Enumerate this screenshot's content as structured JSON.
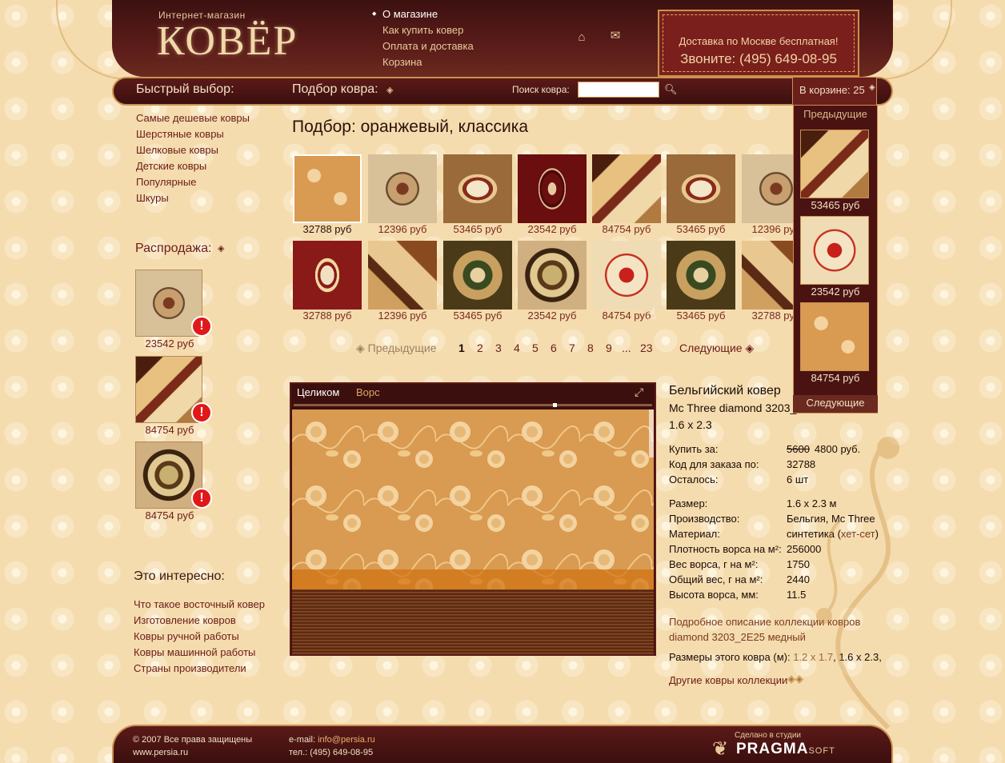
{
  "header": {
    "logo_sub": "Интернет-магазин",
    "logo": "КОВЁР",
    "nav": [
      "О магазине",
      "Как купить ковер",
      "Оплата и доставка",
      "Корзина"
    ],
    "delivery_line1": "Доставка по Москве бесплатная!",
    "delivery_line2": "Звоните: (495) 649-08-95"
  },
  "toolbar": {
    "quick": "Быстрый выбор:",
    "picker": "Подбор ковра:",
    "search_label": "Поиск ковра:",
    "search_value": "",
    "cart_label": "В корзине: 25"
  },
  "sidebar": {
    "categories": [
      "Самые дешевые ковры",
      "Шерстяные ковры",
      "Шелковые ковры",
      "Детские ковры",
      "Популярные",
      "Шкуры"
    ],
    "sale_title": "Распродажа:",
    "sale_items": [
      {
        "price": "23542 руб",
        "pattern": "beige-floral"
      },
      {
        "price": "84754 руб",
        "pattern": "modern-abstract"
      },
      {
        "price": "84754 руб",
        "pattern": "round-medallion"
      }
    ],
    "interest_title": "Это интересно:",
    "interest_links": [
      "Что такое восточный ковер",
      "Изготовление ковров",
      "Ковры ручной работы",
      "Ковры машинной работы",
      "Страны производители"
    ]
  },
  "main": {
    "title": "Подбор: оранжевый, классика",
    "grid": [
      [
        {
          "price": "32788 руб",
          "pattern": "orange-rose",
          "selected": true
        },
        {
          "price": "12396 руб",
          "pattern": "beige-floral"
        },
        {
          "price": "53465 руб",
          "pattern": "oval-medallion"
        },
        {
          "price": "23542 руб",
          "pattern": "red-persian"
        },
        {
          "price": "84754 руб",
          "pattern": "modern-abstract"
        },
        {
          "price": "53465 руб",
          "pattern": "oval-medallion"
        },
        {
          "price": "12396 руб",
          "pattern": "beige-floral"
        }
      ],
      [
        {
          "price": "32788 руб",
          "pattern": "red-frame"
        },
        {
          "price": "12396 руб",
          "pattern": "modern-geo"
        },
        {
          "price": "53465 руб",
          "pattern": "green-floral"
        },
        {
          "price": "23542 руб",
          "pattern": "round-medallion"
        },
        {
          "price": "84754 руб",
          "pattern": "cream-center"
        },
        {
          "price": "53465 руб",
          "pattern": "green-floral"
        },
        {
          "price": "32788 руб",
          "pattern": "modern-geo"
        }
      ]
    ],
    "pager": {
      "prev": "Предыдущие",
      "pages": [
        "1",
        "2",
        "3",
        "4",
        "5",
        "6",
        "7",
        "8",
        "9",
        "...",
        "23"
      ],
      "current": "1",
      "next": "Следующие"
    }
  },
  "viewer": {
    "tab_whole": "Целиком",
    "tab_pile": "Ворс"
  },
  "details": {
    "title": "Бельгийский ковер",
    "model": "Mc Three diamond 3203_",
    "size": "1.6 x 2.3",
    "specs": [
      {
        "label": "Купить за:",
        "old_price": "5600",
        "value": "4800 руб."
      },
      {
        "label": "Код для заказа по:",
        "value": "32788"
      },
      {
        "label": "Осталось:",
        "value": "6 шт"
      },
      {
        "label": "Размер:",
        "value": "1.6 x 2.3 м"
      },
      {
        "label": "Производство:",
        "value": "Бельгия, Mc Three"
      },
      {
        "label": "Материал:",
        "value_prefix": "синтетика (",
        "value_link": "хет-сет",
        "value_suffix": ")"
      },
      {
        "label": "Плотность ворса на м²:",
        "value": "256000"
      },
      {
        "label": "Вес ворса, г на м²:",
        "value": "1750"
      },
      {
        "label": "Общий вес, г на м²:",
        "value": "2440"
      },
      {
        "label": "Высота ворса, мм:",
        "value": "11.5"
      }
    ],
    "description_link": "Подробное описание коллекции ковров diamond 3203_2E25 медный",
    "sizes_label": "Размеры этого ковра (м):",
    "sizes": [
      "1.2 x 1.7",
      "1.6 x 2.3"
    ],
    "other_link": "Другие ковры коллекции"
  },
  "cart_dropdown": {
    "prev": "Предыдущие",
    "items": [
      {
        "price": "53465 руб",
        "pattern": "modern-abstract"
      },
      {
        "price": "23542 руб",
        "pattern": "cream-center"
      },
      {
        "price": "84754 руб",
        "pattern": "orange-rose"
      }
    ],
    "next": "Следующие"
  },
  "footer": {
    "copyright": "© 2007 Все права защищены",
    "site": "www.persia.ru",
    "email_label": "e-mail: ",
    "email": "info@persia.ru",
    "phone": "тел.: (495) 649-08-95",
    "studio": "Сделано в студии",
    "studio_logo": "PRAGMA",
    "studio_logo_small": "SOFT"
  }
}
